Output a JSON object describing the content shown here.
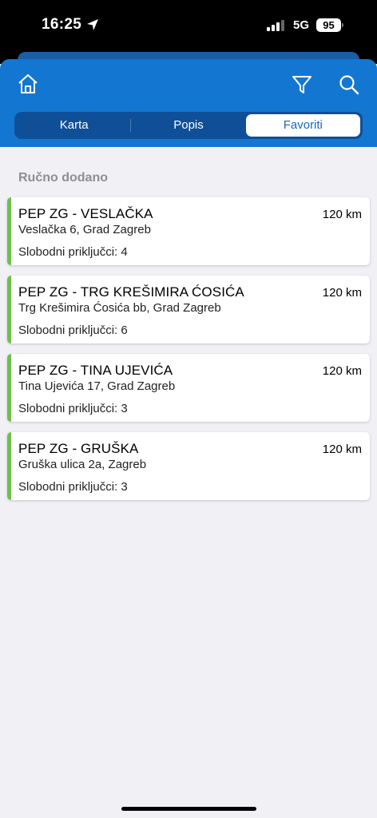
{
  "status_bar": {
    "time": "16:25",
    "network": "5G",
    "battery": "95"
  },
  "header": {
    "icons": [
      "home-icon",
      "filter-icon",
      "search-icon"
    ],
    "color": "#1377d1"
  },
  "tabs": [
    {
      "label": "Karta",
      "active": false
    },
    {
      "label": "Popis",
      "active": false
    },
    {
      "label": "Favoriti",
      "active": true
    }
  ],
  "section": {
    "title": "Ručno dodano"
  },
  "stations": [
    {
      "name": "PEP ZG - VESLAČKA",
      "distance": "120 km",
      "address": "Veslačka 6, Grad Zagreb",
      "free": "Slobodni priključci: 4"
    },
    {
      "name": "PEP ZG - TRG KREŠIMIRA ĆOSIĆA",
      "distance": "120 km",
      "address": "Trg Krešimira Ćosića bb, Grad Zagreb",
      "free": "Slobodni priključci: 6"
    },
    {
      "name": "PEP ZG - TINA UJEVIĆA",
      "distance": "120 km",
      "address": "Tina Ujevića 17, Grad Zagreb",
      "free": "Slobodni priključci: 3"
    },
    {
      "name": "PEP ZG - GRUŠKA",
      "distance": "120 km",
      "address": "Gruška ulica 2a, Zagreb",
      "free": "Slobodni priključci: 3"
    }
  ],
  "colors": {
    "accent": "#1377d1",
    "available": "#6cc24a"
  }
}
